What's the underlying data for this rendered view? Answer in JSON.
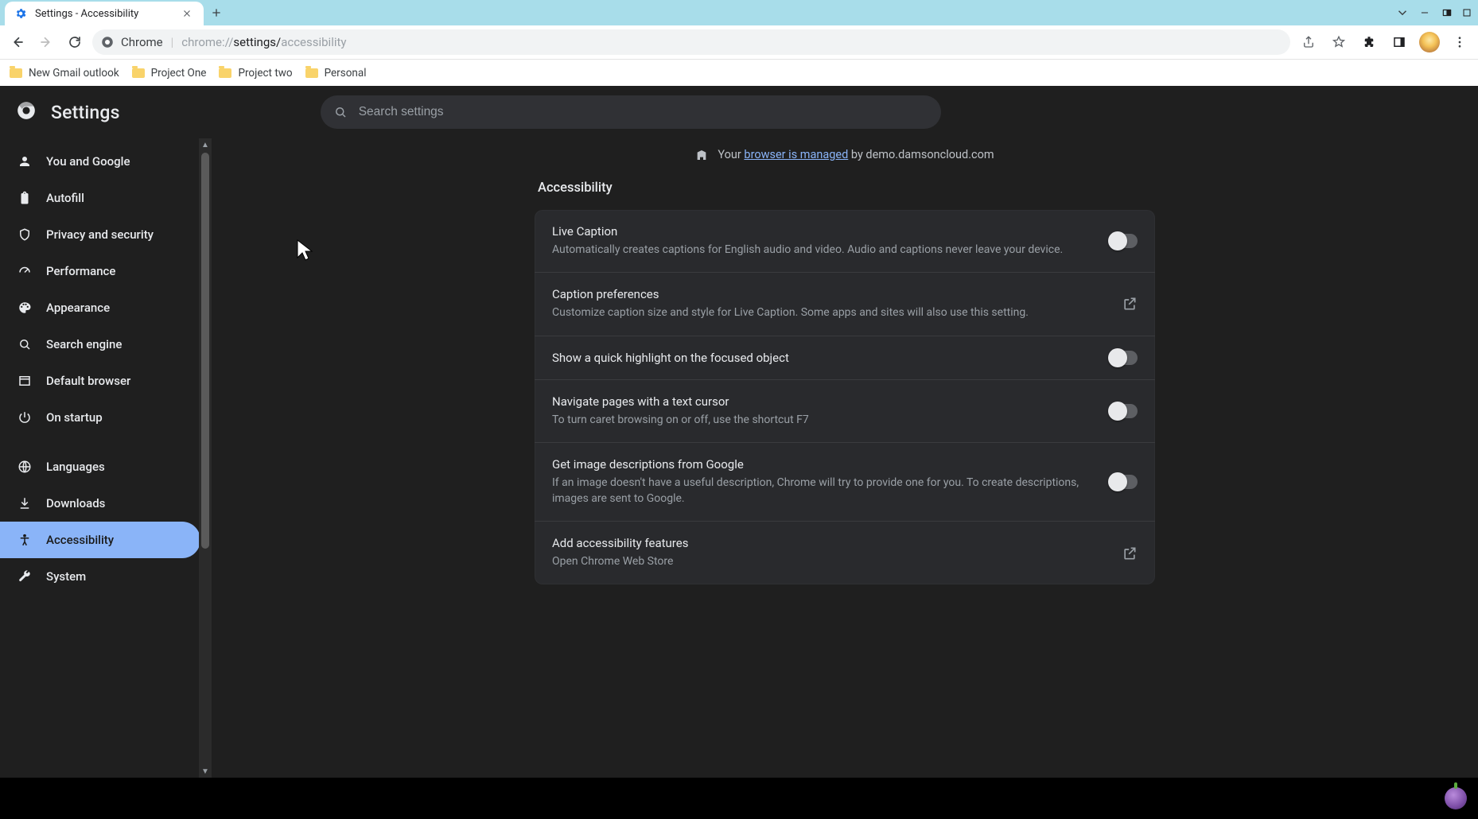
{
  "window": {
    "tab_title": "Settings - Accessibility"
  },
  "omnibox": {
    "site_label": "Chrome",
    "url_prefix": "chrome://",
    "url_mid": "settings/",
    "url_tail": "accessibility"
  },
  "bookmarks": [
    {
      "label": "New Gmail outlook"
    },
    {
      "label": "Project One"
    },
    {
      "label": "Project two"
    },
    {
      "label": "Personal"
    }
  ],
  "app": {
    "title": "Settings",
    "search_placeholder": "Search settings"
  },
  "sidebar": {
    "items": [
      {
        "label": "You and Google",
        "icon": "person"
      },
      {
        "label": "Autofill",
        "icon": "clipboard"
      },
      {
        "label": "Privacy and security",
        "icon": "shield"
      },
      {
        "label": "Performance",
        "icon": "speed"
      },
      {
        "label": "Appearance",
        "icon": "palette"
      },
      {
        "label": "Search engine",
        "icon": "search"
      },
      {
        "label": "Default browser",
        "icon": "window"
      },
      {
        "label": "On startup",
        "icon": "power"
      }
    ],
    "items2": [
      {
        "label": "Languages",
        "icon": "globe"
      },
      {
        "label": "Downloads",
        "icon": "download"
      },
      {
        "label": "Accessibility",
        "icon": "accessibility",
        "selected": true
      },
      {
        "label": "System",
        "icon": "wrench"
      }
    ]
  },
  "managed": {
    "prefix": "Your ",
    "link": "browser is managed",
    "suffix": " by demo.damsoncloud.com"
  },
  "section_title": "Accessibility",
  "rows": [
    {
      "title": "Live Caption",
      "sub": "Automatically creates captions for English audio and video. Audio and captions never leave your device.",
      "type": "toggle"
    },
    {
      "title": "Caption preferences",
      "sub": "Customize caption size and style for Live Caption. Some apps and sites will also use this setting.",
      "type": "launch"
    },
    {
      "title": "Show a quick highlight on the focused object",
      "sub": "",
      "type": "toggle"
    },
    {
      "title": "Navigate pages with a text cursor",
      "sub": "To turn caret browsing on or off, use the shortcut F7",
      "type": "toggle"
    },
    {
      "title": "Get image descriptions from Google",
      "sub": "If an image doesn't have a useful description, Chrome will try to provide one for you. To create descriptions, images are sent to Google.",
      "type": "toggle"
    },
    {
      "title": "Add accessibility features",
      "sub": "Open Chrome Web Store",
      "type": "launch"
    }
  ]
}
